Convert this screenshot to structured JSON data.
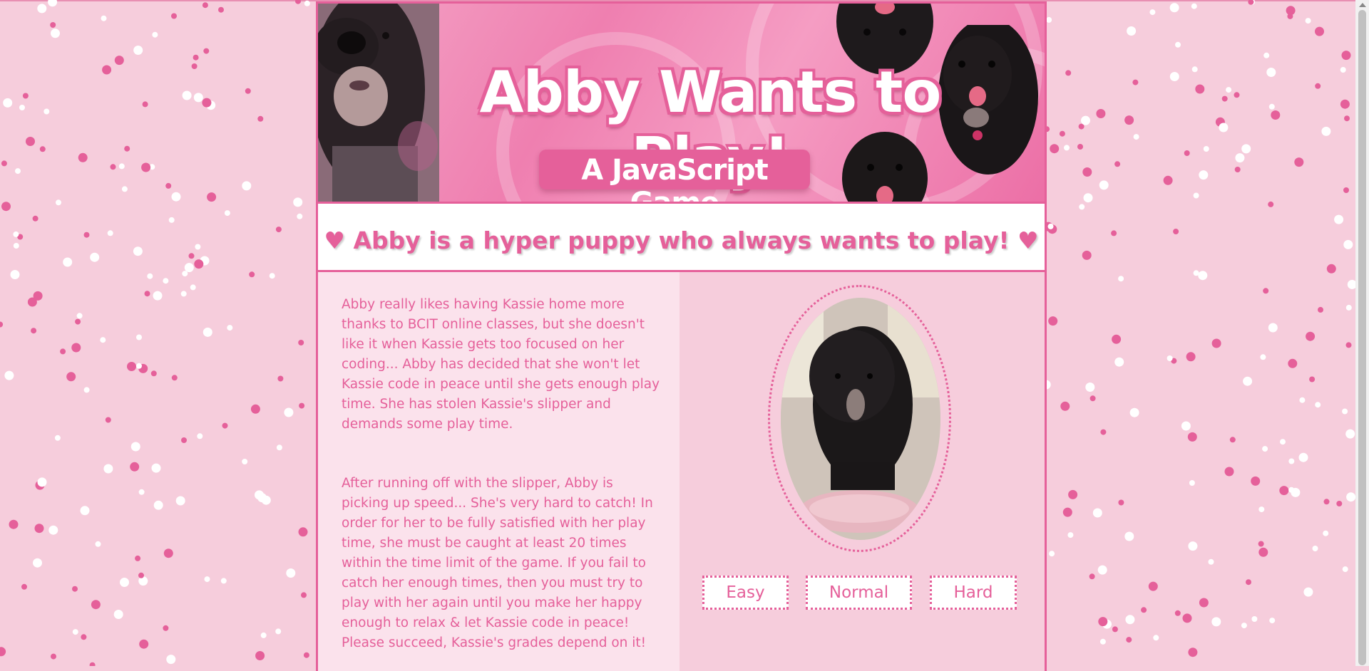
{
  "banner": {
    "title": "Abby Wants to Play!",
    "subtitle": "A JavaScript Game"
  },
  "tagline": "♥ Abby is a hyper puppy who always wants to play! ♥",
  "story": {
    "paragraph1": "Abby really likes having Kassie home more thanks to BCIT online classes, but she doesn't like it when Kassie gets too focused on her coding... Abby has decided that she won't let Kassie code in peace until she gets enough play time. She has stolen Kassie's slipper and demands some play time.",
    "paragraph2": "After running off with the slipper, Abby is picking up speed... She's very hard to catch! In order for her to be fully satisfied with her play time, she must be caught at least 20 times within the time limit of the game. If you fail to catch her enough times, then you must try to play with her again until you make her happy enough to relax & let Kassie code in peace! Please succeed, Kassie's grades depend on it!"
  },
  "difficulty": {
    "easy": "Easy",
    "normal": "Normal",
    "hard": "Hard"
  },
  "colors": {
    "accent": "#e5609a",
    "background": "#f6cddc",
    "panel_light": "#fbe2ec",
    "white": "#ffffff"
  }
}
